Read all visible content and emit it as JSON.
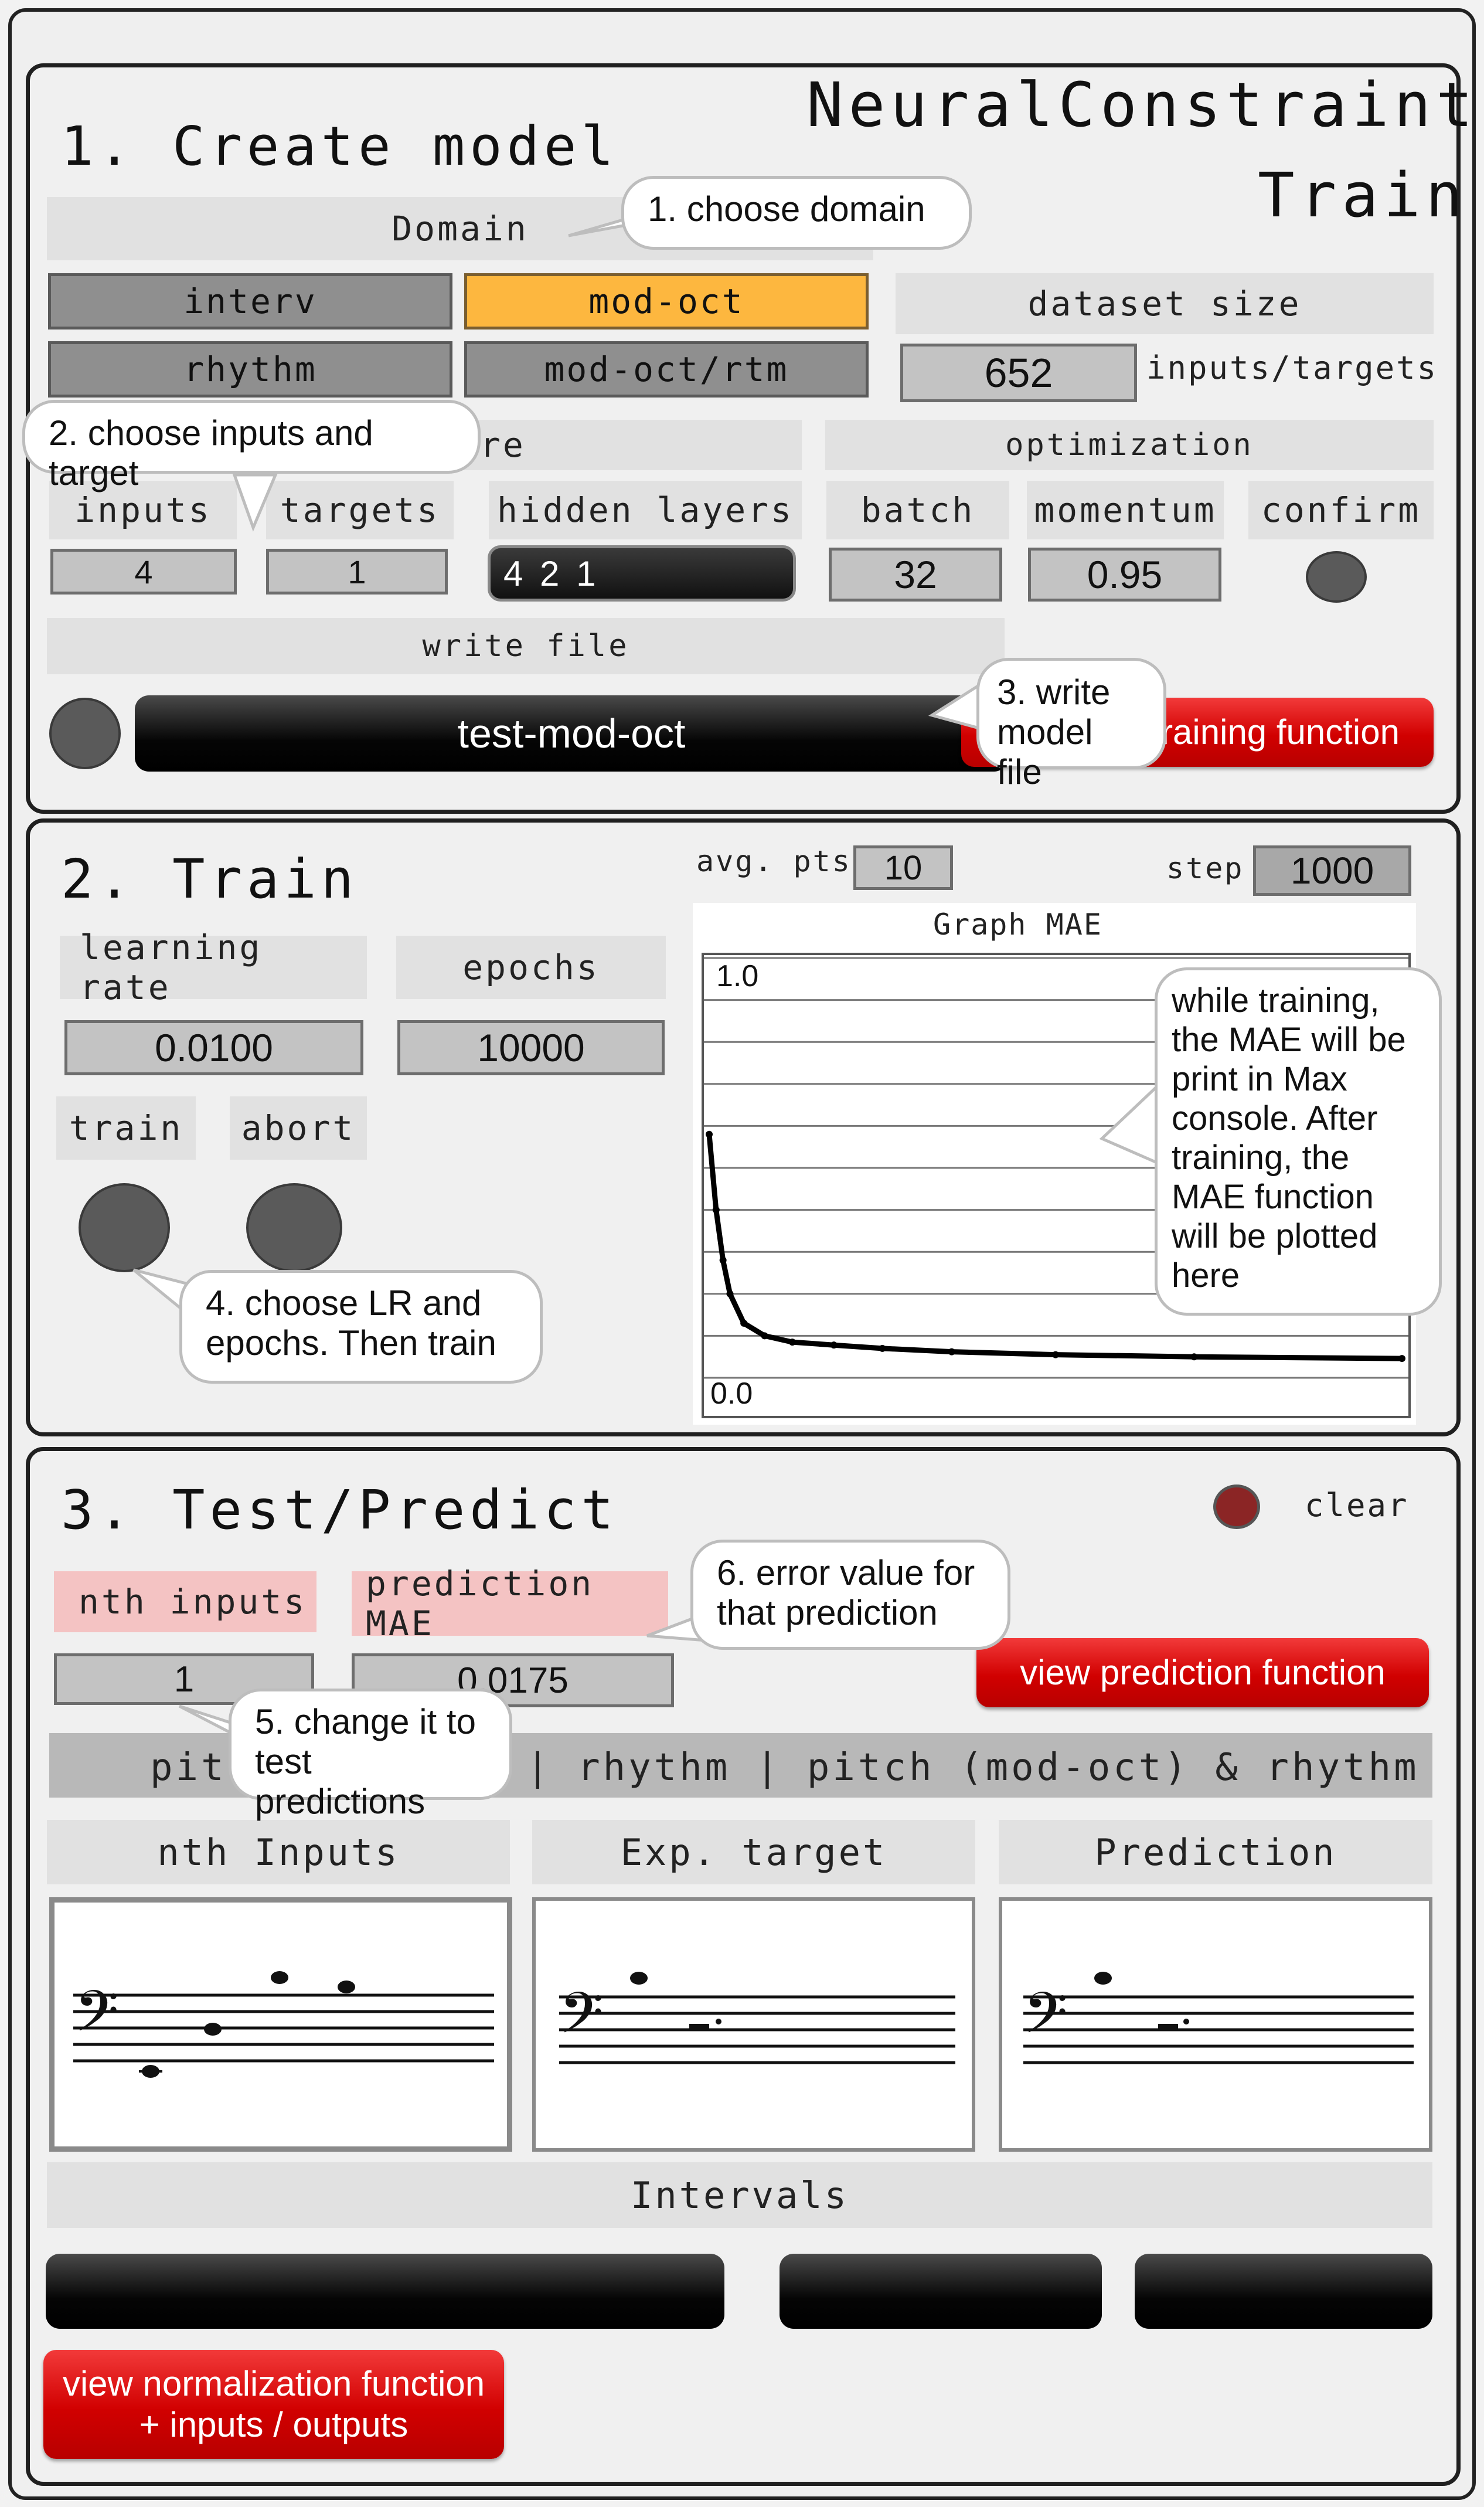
{
  "window": {
    "label": "input"
  },
  "brand": {
    "line1": "NeuralConstraints",
    "line2": "Train"
  },
  "create": {
    "title": "1. Create model",
    "domain_label": "Domain",
    "domains": [
      "interv",
      "mod-oct",
      "rhythm",
      "mod-oct/rtm"
    ],
    "selected_domain": "mod-oct",
    "dataset_label": "dataset size",
    "dataset_value": "652",
    "dataset_unit": "inputs/targets",
    "architecture_label": "ure",
    "inputs_label": "inputs",
    "targets_label": "targets",
    "hidden_label": "hidden layers",
    "optimization_label": "optimization",
    "batch_label": "batch",
    "momentum_label": "momentum",
    "confirm_label": "confirm",
    "inputs_value": "4",
    "targets_value": "1",
    "hidden_value": "4 2 1",
    "batch_value": "32",
    "momentum_value": "0.95",
    "write_label": "write file",
    "file_name": "test-mod-oct",
    "training_fn": "raining function"
  },
  "train": {
    "title": "2. Train",
    "avg_label": "avg. pts",
    "avg_value": "10",
    "step_label": "step",
    "step_value": "1000",
    "lr_label": "learning rate",
    "epochs_label": "epochs",
    "lr_value": "0.0100",
    "epochs_value": "10000",
    "train_label": "train",
    "abort_label": "abort",
    "graph_title": "Graph MAE",
    "graph_max": "1.0",
    "graph_min": "0.0"
  },
  "chart_data": {
    "type": "line",
    "title": "Graph MAE",
    "ylim": [
      0,
      1
    ],
    "x": [
      0,
      1,
      2,
      3,
      5,
      8,
      12,
      18,
      25,
      35,
      50,
      70,
      100
    ],
    "series": [
      {
        "values": [
          0.58,
          0.4,
          0.28,
          0.2,
          0.13,
          0.1,
          0.085,
          0.078,
          0.07,
          0.062,
          0.055,
          0.05,
          0.046
        ]
      }
    ]
  },
  "test": {
    "title": "3. Test/Predict",
    "clear_label": "clear",
    "nth_label": "nth inputs",
    "pred_mae_label": "prediction MAE",
    "nth_value": "1",
    "pred_mae_value": "0.0175",
    "view_pred": "view prediction function",
    "domain_bar_left": "pitc",
    "domain_bar_right": "| rhythm | pitch (mod-oct) & rhythm",
    "col1": "nth Inputs",
    "col2": "Exp. target",
    "col3": "Prediction",
    "intervals_label": "Intervals",
    "view_norm": "view normalization function\n+ inputs / outputs"
  },
  "callouts": {
    "c1": "1. choose domain",
    "c2": "2. choose inputs and target",
    "c3": "3. write\nmodel file",
    "c4": "4. choose LR and\nepochs. Then train",
    "c5": "5. change it to\ntest predictions",
    "c6": "6. error value for\nthat prediction",
    "c_mae": "while training,\nthe MAE will be\nprint in Max\nconsole. After\ntraining, the\nMAE function\nwill be plotted\nhere"
  }
}
